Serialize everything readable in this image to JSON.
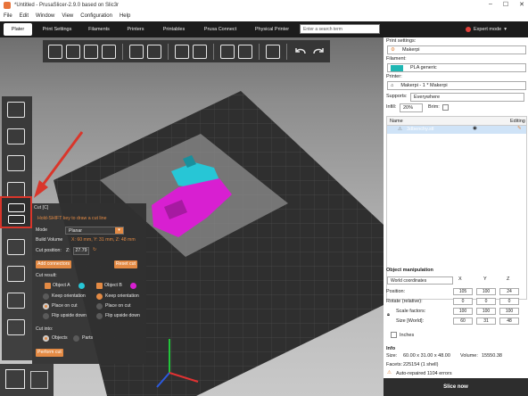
{
  "window": {
    "title": "*Untitled - PrusaSlicer-2.9.0 based on Slic3r",
    "controls": [
      "–",
      "☐",
      "✕"
    ]
  },
  "menu": [
    "File",
    "Edit",
    "Window",
    "View",
    "Configuration",
    "Help"
  ],
  "tabs": [
    "Plater",
    "Print Settings",
    "Filaments",
    "Printers",
    "Printables",
    "Prusa Connect",
    "Physical Printer"
  ],
  "search": {
    "placeholder": "Enter a search term"
  },
  "mode": {
    "label": "Expert mode",
    "color": "#e0403a"
  },
  "accent": "#e38a44",
  "cut_panel": {
    "title": "Cut [C]",
    "hint": "Hold-SHIFT key to draw a cut line",
    "mode_label": "Mode",
    "mode_value": "Planar",
    "build_volume_label": "Build Volume",
    "build_volume_value": "X: 60 mm,  Y: 31 mm,  Z: 48 mm",
    "cut_position_label": "Cut position:",
    "z_label": "Z:",
    "z_value": "27.79",
    "add_connectors": "Add connectors",
    "reset_cut": "Reset cut",
    "cut_result_label": "Cut result:",
    "object_a": "Object A",
    "object_b": "Object B",
    "object_a_color": "#27c6d6",
    "object_b_color": "#d81fd1",
    "keep_orientation": "Keep orientation",
    "place_on_cut": "Place on cut",
    "flip_upside_down": "Flip upside down",
    "cut_into_label": "Cut into:",
    "objects": "Objects",
    "parts": "Parts",
    "perform_cut": "Perform cut"
  },
  "right": {
    "print_settings_label": "Print settings:",
    "print_settings_value": "Makerpi",
    "filament_label": "Filament:",
    "filament_value": "PLA generic",
    "filament_color": "#20b7b3",
    "printer_label": "Printer:",
    "printer_value": "Makerpi - 1 * Makerpi",
    "supports_label": "Supports:",
    "supports_value": "Everywhere",
    "infill_label": "Infill:",
    "infill_value": "20%",
    "brim_label": "Brim:",
    "list_name_header": "Name",
    "list_editing_header": "Editing",
    "object_row": "3dbenchy.stl",
    "object_manipulation": "Object manipulation",
    "coords": "World coordinates",
    "x": "X",
    "y": "Y",
    "z": "Z",
    "position_label": "Position:",
    "position": [
      "105",
      "100",
      "24"
    ],
    "rotate_label": "Rotate (relative):",
    "rotate": [
      "0",
      "0",
      "0"
    ],
    "scale_label": "Scale factors:",
    "scale": [
      "100",
      "100",
      "100"
    ],
    "size_label": "Size [World]:",
    "size": [
      "60",
      "31",
      "48"
    ],
    "inches_label": "Inches",
    "info_label": "Info",
    "size_info_label": "Size:",
    "size_info": "60.00 x 31.00 x 48.00",
    "volume_label": "Volume:",
    "volume": "15550.38",
    "facets_label": "Facets:",
    "facets": "225154 (1 shell)",
    "repaired": "Auto-repaired 1104 errors",
    "slice_now": "Slice now"
  }
}
